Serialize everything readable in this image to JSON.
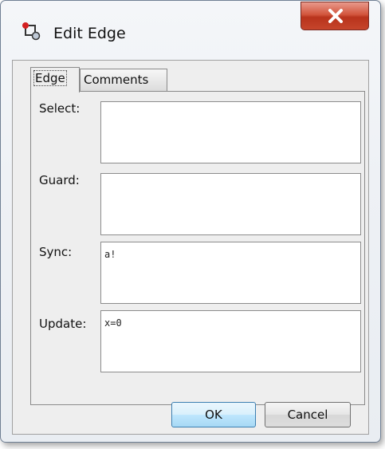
{
  "window": {
    "title": "Edit Edge",
    "close_label": "X"
  },
  "tabs": [
    {
      "label": "Edge",
      "active": true
    },
    {
      "label": "Comments",
      "active": false
    }
  ],
  "fields": {
    "select": {
      "label": "Select:",
      "value": ""
    },
    "guard": {
      "label": "Guard:",
      "value": ""
    },
    "sync": {
      "label": "Sync:",
      "value": "a!"
    },
    "update": {
      "label": "Update:",
      "value": "x=0"
    }
  },
  "buttons": {
    "ok_label": "OK",
    "cancel_label": "Cancel"
  },
  "icons": {
    "app": "edge-graph-icon",
    "close": "close-icon"
  },
  "colors": {
    "close_button": "#c6452b",
    "default_button_border": "#3c7fb1"
  }
}
